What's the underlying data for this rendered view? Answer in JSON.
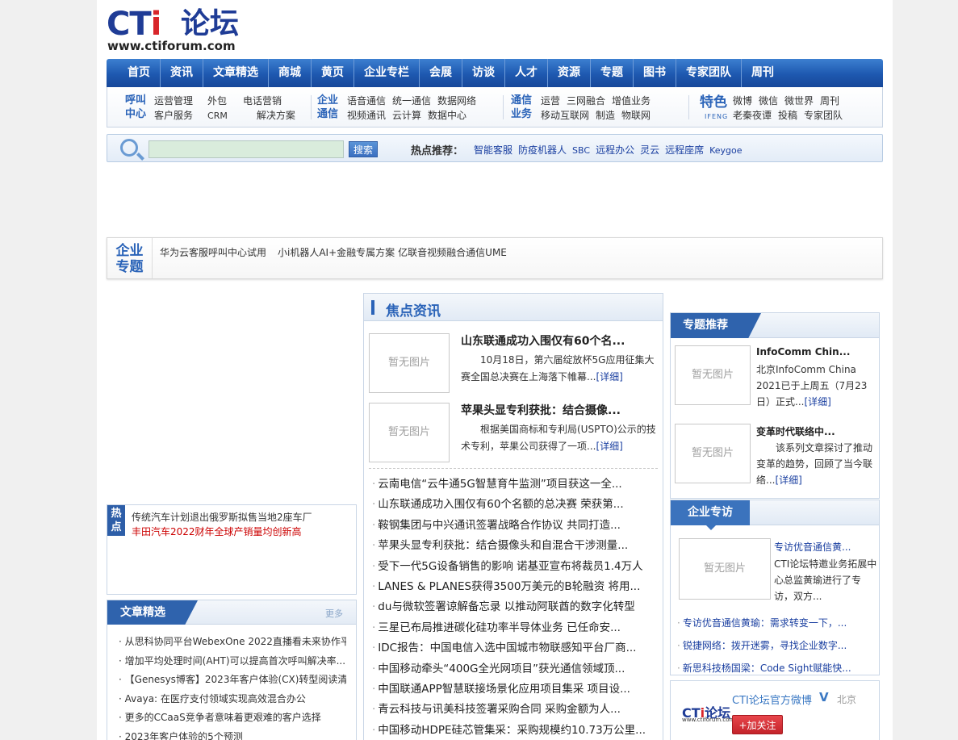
{
  "logo": {
    "cti": "CT",
    "cti_i": "i",
    "cn": "论坛",
    "url": "www.ctiforum.com"
  },
  "nav": [
    "首页",
    "资讯",
    "文章精选",
    "商城",
    "黄页",
    "企业专栏",
    "会展",
    "访谈",
    "人才",
    "资源",
    "专题",
    "图书",
    "专家团队",
    "周刊"
  ],
  "subnav": {
    "call_center": {
      "head1": "呼叫",
      "head2": "中心",
      "row1": [
        "运营管理",
        "外包",
        "电话营销"
      ],
      "row2": [
        "客户服务",
        "CRM",
        "解决方案"
      ]
    },
    "enterprise_comm": {
      "head1": "企业",
      "head2": "通信",
      "row1": [
        "语音通信",
        "统一通信",
        "数据网络"
      ],
      "row2": [
        "视频通讯",
        "云计算",
        "数据中心"
      ]
    },
    "comm_business": {
      "head1": "通信",
      "head2": "业务",
      "row1": [
        "运营",
        "三网融合",
        "增值业务"
      ],
      "row2": [
        "移动互联网",
        "制造",
        "物联网"
      ]
    },
    "featured": {
      "head": "特色",
      "small": "IFENG",
      "row1": [
        "微博",
        "微信",
        "微世界",
        "周刊"
      ],
      "row2": [
        "老秦夜谭",
        "投稿",
        "专家团队"
      ]
    }
  },
  "search": {
    "button": "搜索",
    "hot_label": "热点推荐：",
    "hot_links": [
      "智能客服",
      "防疫机器人",
      "SBC",
      "远程办公",
      "灵云",
      "远程座席",
      "Keygoe"
    ]
  },
  "enterprise_topic": {
    "head1": "企业",
    "head2": "专题",
    "links": [
      "华为云客服呼叫中心试用",
      "小i机器人AI+金融专属方案",
      "亿联音视频融合通信UME"
    ]
  },
  "hot_box": {
    "head": "热点",
    "items": [
      "传统汽车计划退出俄罗斯拟售当地2座车厂",
      "丰田汽车2022财年全球产销量均创新高"
    ],
    "item_colors": [
      "#222222",
      "#cc0000"
    ]
  },
  "articles": {
    "title": "文章精选",
    "more": "更多",
    "items": [
      "从思科协同平台WebexOne 2022直播看未来协作平...",
      "增加平均处理时间(AHT)可以提高首次呼叫解决率...",
      "【Genesys博客】2023年客户体验(CX)转型阅读清单",
      "Avaya: 在医疗支付领域实现高效混合办公",
      "更多的CCaaS竞争者意味着更艰难的客户选择",
      "2023年客户体验的5个预测"
    ]
  },
  "focus": {
    "title": "焦点资讯",
    "no_image": "暂无图片",
    "featured": [
      {
        "title": "山东联通成功入围仅有60个名...",
        "desc": "10月18日，第六届绽放杯5G应用征集大赛全国总决赛在上海落下帷幕...",
        "detail": "[详细]"
      },
      {
        "title": "苹果头显专利获批：结合摄像...",
        "desc": "根据美国商标和专利局(USPTO)公示的技术专利，苹果公司获得了一项...",
        "detail": "[详细]"
      }
    ],
    "news": [
      "云南电信“云牛通5G智慧育牛监测”项目获这一全...",
      "山东联通成功入围仅有60个名额的总决赛 荣获第...",
      "鞍钢集团与中兴通讯签署战略合作协议 共同打造...",
      "苹果头显专利获批：结合摄像头和自混合干涉测量...",
      "受下一代5G设备销售的影响 诺基亚宣布将裁员1.4万人",
      "LANES & PLANES获得3500万美元的B轮融资 将用...",
      "du与微软签署谅解备忘录 以推动阿联酋的数字化转型",
      "三星已布局推进碳化硅功率半导体业务 已任命安...",
      "IDC报告：中国电信入选中国城市物联感知平台厂商...",
      "中国移动牵头“400G全光网项目”获光通信领域顶...",
      "中国联通APP智慧联接场景化应用项目集采 项目设...",
      "青云科技与讯美科技签署采购合同 采购金额为人...",
      "中国移动HDPE硅芯管集采：采购规模约10.73万公里..."
    ]
  },
  "topic_recommend": {
    "title": "专题推荐",
    "no_image": "暂无图片",
    "items": [
      {
        "title": "InfoComm Chin...",
        "desc": "北京InfoComm China 2021已于上周五（7月23日）正式...",
        "detail": "[详细]"
      },
      {
        "title": "变革时代联络中...",
        "desc": "该系列文章探讨了推动变革的趋势，回顾了当今联络...",
        "detail": "[详细]"
      }
    ]
  },
  "interview": {
    "title": "企业专访",
    "no_image": "暂无图片",
    "feature_title": "专访优音通信黄...",
    "feature_desc": "CTI论坛特邀业务拓展中心总监黄瑜进行了专访，双方...",
    "list": [
      "专访优音通信黄瑜：需求转变一下，...",
      "锐捷网络：拨开迷雾，寻找企业数字...",
      "新思科技杨国梁：Code Sight赋能快..."
    ]
  },
  "weibo": {
    "logo_cti": "CT",
    "logo_i": "i",
    "logo_cn": "论坛",
    "logo_url": "www.ctiforum.com",
    "name": "CTI论坛官方微博",
    "v": "V",
    "city": "北京",
    "follow": "+加关注"
  }
}
